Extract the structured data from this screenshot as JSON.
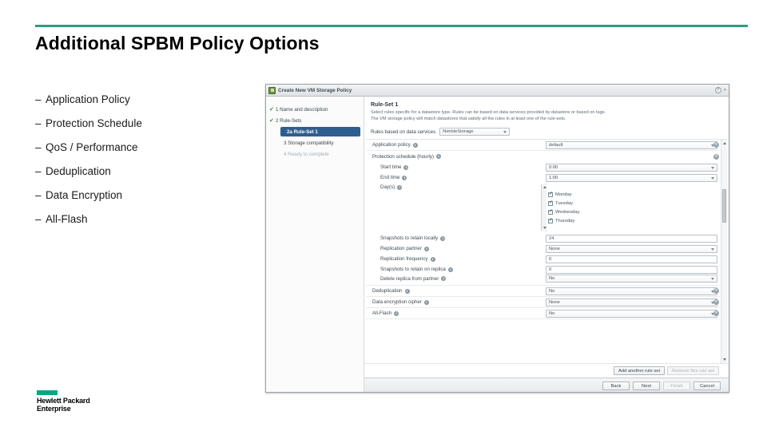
{
  "slide": {
    "title": "Additional SPBM Policy Options",
    "bullets": [
      {
        "dash": "–",
        "text": "Application Policy"
      },
      {
        "dash": "–",
        "text": "Protection Schedule"
      },
      {
        "dash": "–",
        "text": "QoS / Performance"
      },
      {
        "dash": "–",
        "text": "Deduplication"
      },
      {
        "dash": "–",
        "text": "Data Encryption"
      },
      {
        "dash": "–",
        "text": "All-Flash"
      }
    ],
    "accent_color": "#2e9b82",
    "logo": {
      "line1": "Hewlett Packard",
      "line2": "Enterprise",
      "color": "#01a982"
    }
  },
  "wizard": {
    "title": "Create New VM Storage Policy",
    "title_icon": "storage-policy-icon",
    "help_icon": "?",
    "collapse_icon": "»",
    "nav": [
      {
        "check": "✔",
        "label": "1  Name and description",
        "state": "done"
      },
      {
        "check": "✔",
        "label": "2  Rule-Sets",
        "state": "done"
      },
      {
        "check": "",
        "label": "2a  Rule-Set 1",
        "state": "selected"
      },
      {
        "check": "",
        "label": "3  Storage compatibility",
        "state": "normal"
      },
      {
        "check": "",
        "label": "4  Ready to complete",
        "state": "disabled"
      }
    ],
    "heading": "Rule-Set 1",
    "description_line1": "Select rules specific for a datastore type. Rules can be based on data services provided by datastore or based on tags.",
    "description_line2": "The VM storage policy will match datastores that satisfy all the rules in at least one of the rule-sets.",
    "data_services": {
      "label": "Rules based on data services",
      "value": "NimbleStorage",
      "icon": "chevron-down-icon"
    },
    "groups": [
      {
        "name": "application-policy",
        "label": "Application policy",
        "info": "i",
        "control": "select",
        "value": "default",
        "removable": true
      },
      {
        "name": "protection-schedule",
        "label": "Protection schedule (hourly)",
        "info": "i",
        "control": "header",
        "removable": true,
        "rows": [
          {
            "name": "start-time",
            "label": "Start time",
            "control": "select",
            "value": "0:00"
          },
          {
            "name": "end-time",
            "label": "End time",
            "control": "select",
            "value": "1:00"
          },
          {
            "name": "days",
            "label": "Day(s)",
            "control": "listbox",
            "options": [
              {
                "label": "Monday",
                "checked": true
              },
              {
                "label": "Tuesday",
                "checked": true
              },
              {
                "label": "Wednesday",
                "checked": true
              },
              {
                "label": "Thursday",
                "checked": true
              }
            ]
          },
          {
            "name": "snapshots-retain-locally",
            "label": "Snapshots to retain locally",
            "control": "text",
            "value": "24"
          },
          {
            "name": "replication-partner",
            "label": "Replication partner",
            "control": "select",
            "value": "None"
          },
          {
            "name": "replication-frequency",
            "label": "Replication frequency",
            "control": "text",
            "value": "0"
          },
          {
            "name": "snapshots-retain-on-replica",
            "label": "Snapshots to retain on replica",
            "control": "text",
            "value": "0"
          },
          {
            "name": "delete-replica-from-partner",
            "label": "Delete replica from partner",
            "control": "select",
            "value": "No"
          }
        ]
      },
      {
        "name": "deduplication",
        "label": "Deduplication",
        "info": "i",
        "control": "select",
        "value": "No",
        "removable": true
      },
      {
        "name": "data-encryption-cipher",
        "label": "Data encryption cipher",
        "info": "i",
        "control": "select",
        "value": "None",
        "removable": true
      },
      {
        "name": "all-flash",
        "label": "All-Flash",
        "info": "i",
        "control": "select",
        "value": "No",
        "removable": true
      }
    ],
    "ruleset_buttons": [
      {
        "name": "add-another-rule-set",
        "label": "Add another rule set",
        "disabled": false
      },
      {
        "name": "remove-this-rule-set",
        "label": "Remove this rule set",
        "disabled": true
      }
    ],
    "footer_buttons": [
      {
        "name": "back",
        "label": "Back",
        "disabled": false
      },
      {
        "name": "next",
        "label": "Next",
        "disabled": false
      },
      {
        "name": "finish",
        "label": "Finish",
        "disabled": true
      },
      {
        "name": "cancel",
        "label": "Cancel",
        "disabled": false
      }
    ]
  }
}
